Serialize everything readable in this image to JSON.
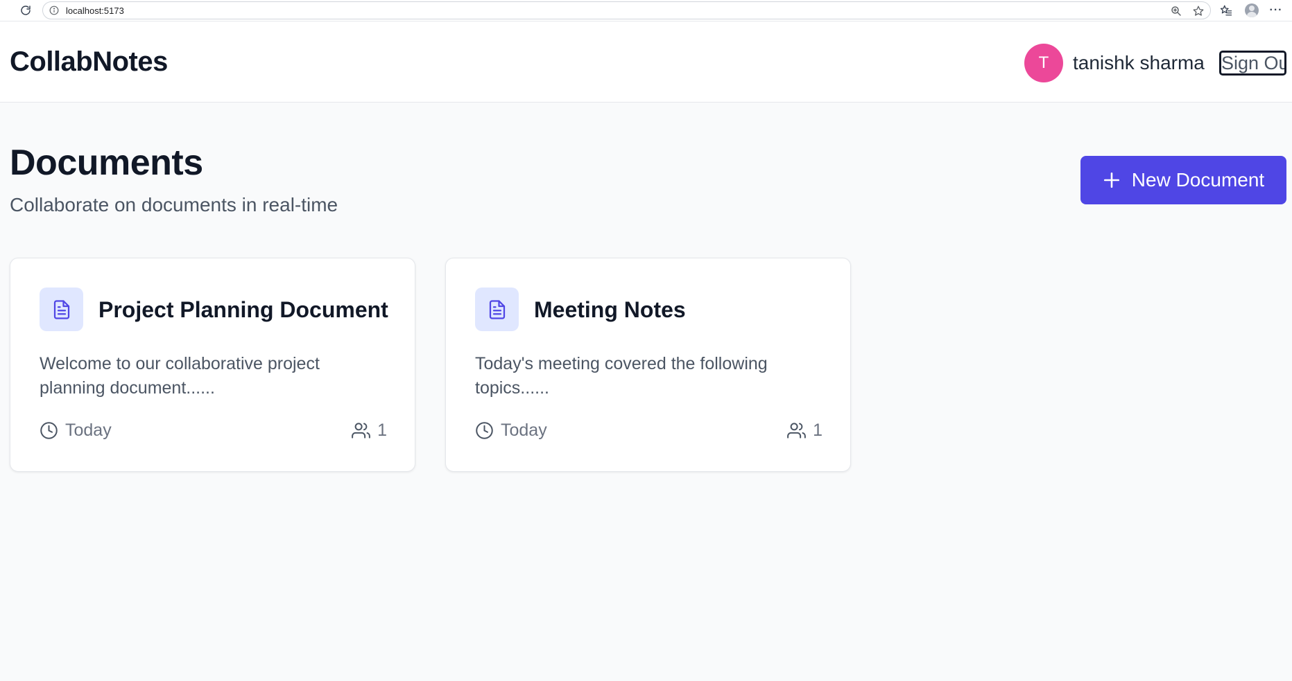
{
  "browser": {
    "url": "localhost:5173"
  },
  "header": {
    "app_title": "CollabNotes",
    "user": {
      "initial": "T",
      "name": "tanishk sharma",
      "avatar_color": "#ec4899"
    },
    "sign_out_label": "Sign Out"
  },
  "main": {
    "title": "Documents",
    "subtitle": "Collaborate on documents in real-time",
    "new_document_label": "New Document",
    "accent_color": "#4f46e5"
  },
  "documents": [
    {
      "title": "Project Planning Document",
      "excerpt": "Welcome to our collaborative project planning document......",
      "updated": "Today",
      "collaborators": "1",
      "icon": "file-text-icon"
    },
    {
      "title": "Meeting Notes",
      "excerpt": "Today's meeting covered the following topics......",
      "updated": "Today",
      "collaborators": "1",
      "icon": "file-text-icon"
    }
  ]
}
